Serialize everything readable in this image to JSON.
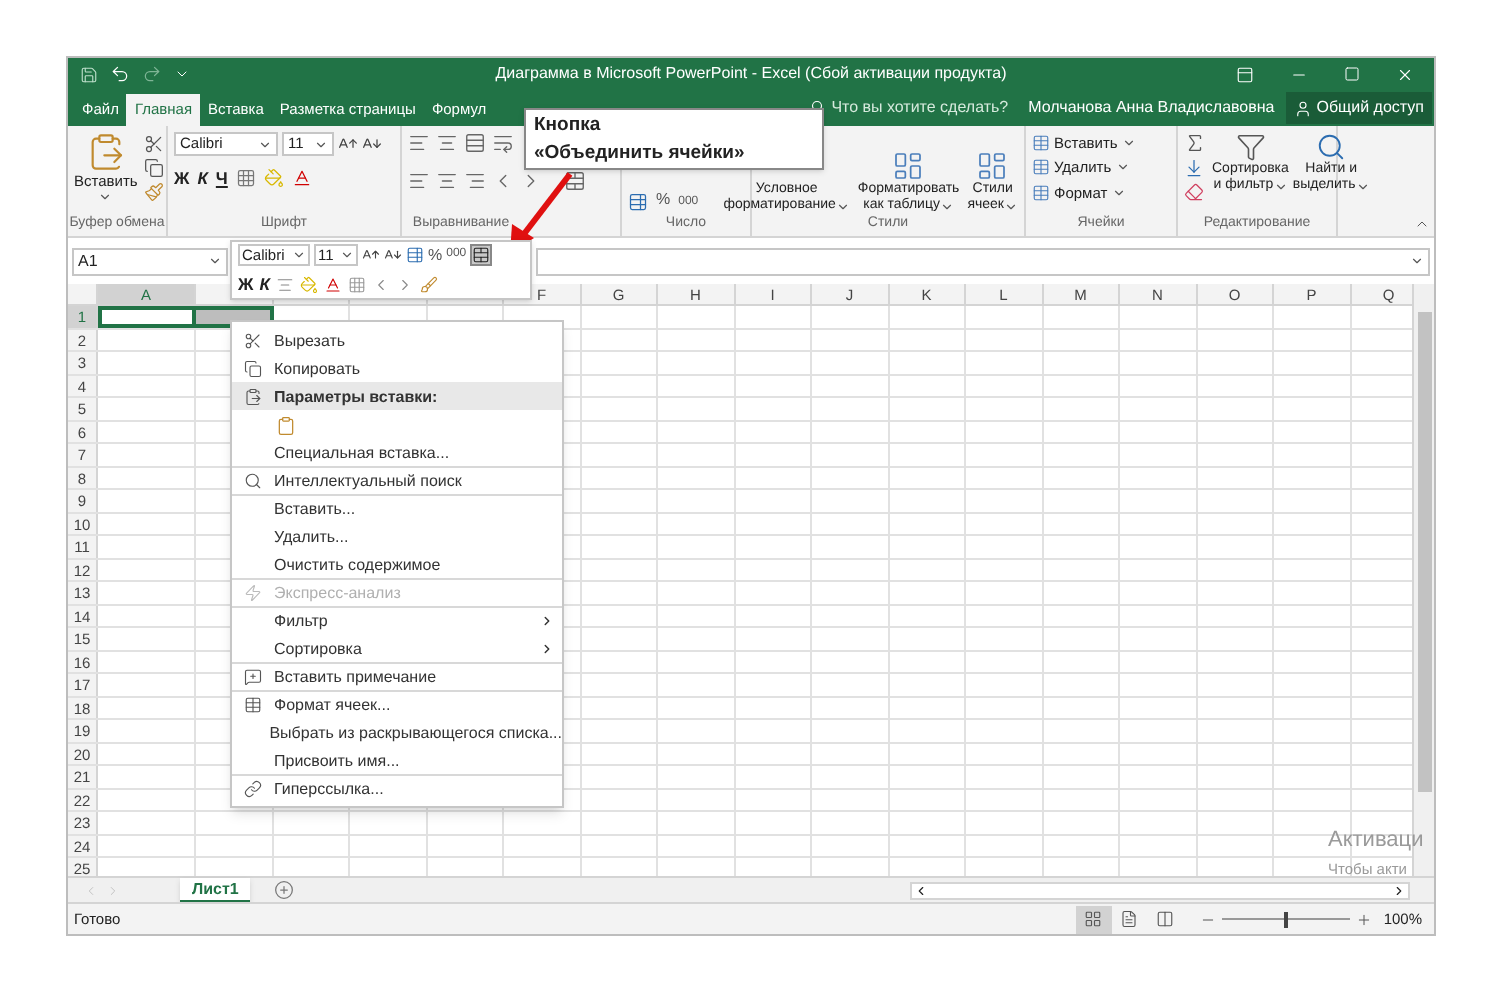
{
  "window": {
    "title": "Диаграмма в Microsoft PowerPoint - Excel (Сбой активации продукта)"
  },
  "tabs": [
    {
      "label": "Файл",
      "selected": false
    },
    {
      "label": "Главная",
      "selected": true
    },
    {
      "label": "Вставка",
      "selected": false
    },
    {
      "label": "Разметка страницы",
      "selected": false
    },
    {
      "label": "Формул",
      "selected": false
    }
  ],
  "tell_me": "Что вы хотите сделать?",
  "user": "Молчанова Анна Владиславовна",
  "share": "Общий доступ",
  "callout": {
    "lines": [
      "Кнопка",
      "«Объединить ячейки»"
    ]
  },
  "ribbon": {
    "clipboard": {
      "label": "Буфер обмена",
      "paste": "Вставить"
    },
    "font": {
      "label": "Шрифт",
      "family": "Calibri",
      "size": "11",
      "bold": "Ж",
      "italic": "К",
      "underline": "Ч"
    },
    "alignment": {
      "label": "Выравнивание"
    },
    "number": {
      "label": "Число",
      "percent": "%",
      "thousands": "000"
    },
    "styles": {
      "label": "Стили",
      "buttons": [
        [
          "Условное",
          "форматирование"
        ],
        [
          "Форматировать",
          "как таблицу"
        ],
        [
          "Стили",
          "ячеек"
        ]
      ]
    },
    "cells": {
      "label": "Ячейки",
      "buttons": [
        "Вставить",
        "Удалить",
        "Формат"
      ]
    },
    "editing": {
      "label": "Редактирование",
      "buttons": [
        [
          "Сортировка",
          "и фильтр"
        ],
        [
          "Найти и",
          "выделить"
        ]
      ]
    }
  },
  "name_box": "A1",
  "mini_toolbar": {
    "family": "Calibri",
    "size": "11",
    "percent": "%",
    "thousands": "000",
    "bold": "Ж",
    "italic": "К"
  },
  "grid": {
    "columns": [
      {
        "label": "A",
        "selected": true
      },
      {
        "selected": true
      },
      {},
      {},
      {},
      {
        "label": "F",
        "selected": false
      },
      {
        "label": "G",
        "selected": false
      },
      {
        "label": "H",
        "selected": false
      },
      {
        "label": "I",
        "selected": false
      },
      {
        "label": "J",
        "selected": false
      },
      {
        "label": "K",
        "selected": false
      },
      {
        "label": "L",
        "selected": false
      },
      {
        "label": "M",
        "selected": false
      },
      {
        "label": "N",
        "selected": false
      },
      {
        "label": "O",
        "selected": false
      },
      {
        "label": "P",
        "selected": false
      },
      {
        "label": "Q",
        "selected": false
      }
    ],
    "rows": [
      {
        "label": "1",
        "selected": true
      },
      {
        "label": "2",
        "selected": false
      },
      {
        "label": "3",
        "selected": false
      },
      {
        "label": "4",
        "selected": false
      },
      {
        "label": "5",
        "selected": false
      },
      {
        "label": "6",
        "selected": false
      },
      {
        "label": "7",
        "selected": false
      },
      {
        "label": "8",
        "selected": false
      },
      {
        "label": "9",
        "selected": false
      },
      {
        "label": "10",
        "selected": false
      },
      {
        "label": "11",
        "selected": false
      },
      {
        "label": "12",
        "selected": false
      },
      {
        "label": "13",
        "selected": false
      },
      {
        "label": "14",
        "selected": false
      },
      {
        "label": "15",
        "selected": false
      },
      {
        "label": "16",
        "selected": false
      },
      {
        "label": "17",
        "selected": false
      },
      {
        "label": "18",
        "selected": false
      },
      {
        "label": "19",
        "selected": false
      },
      {
        "label": "20",
        "selected": false
      },
      {
        "label": "21",
        "selected": false
      },
      {
        "label": "22",
        "selected": false
      },
      {
        "label": "23",
        "selected": false
      },
      {
        "label": "24",
        "selected": false
      },
      {
        "label": "25",
        "selected": false
      }
    ]
  },
  "context_menu": [
    {
      "kind": "item",
      "label": "Вырезать",
      "disabled": false,
      "separator_before": false
    },
    {
      "kind": "item",
      "label": "Копировать",
      "disabled": false,
      "separator_before": false
    },
    {
      "kind": "header",
      "label": "Параметры вставки:",
      "disabled": false,
      "separator_before": false
    },
    {
      "kind": "paste-options",
      "disabled": false
    },
    {
      "kind": "item",
      "label": "Специальная вставка...",
      "disabled": false,
      "separator_before": false
    },
    {
      "kind": "item",
      "label": "Интеллектуальный поиск",
      "disabled": false,
      "separator_before": true
    },
    {
      "kind": "item",
      "label": "Вставить...",
      "disabled": false,
      "separator_before": true
    },
    {
      "kind": "item",
      "label": "Удалить...",
      "disabled": false,
      "separator_before": false
    },
    {
      "kind": "item",
      "label": "Очистить содержимое",
      "disabled": false,
      "separator_before": false
    },
    {
      "kind": "item",
      "label": "Экспресс-анализ",
      "disabled": true,
      "separator_before": true
    },
    {
      "kind": "submenu",
      "label": "Фильтр",
      "disabled": false,
      "separator_before": true
    },
    {
      "kind": "submenu",
      "label": "Сортировка",
      "disabled": false,
      "separator_before": false
    },
    {
      "kind": "item",
      "label": "Вставить примечание",
      "disabled": false,
      "separator_before": true
    },
    {
      "kind": "item",
      "label": "Формат ячеек...",
      "disabled": false,
      "separator_before": true
    },
    {
      "kind": "item",
      "label": "Выбрать из раскрывающегося списка...",
      "disabled": false,
      "separator_before": false
    },
    {
      "kind": "item",
      "label": "Присвоить имя...",
      "disabled": false,
      "separator_before": false
    },
    {
      "kind": "item",
      "label": "Гиперссылка...",
      "disabled": false,
      "separator_before": true
    }
  ],
  "sheets": [
    {
      "label": "Лист1",
      "selected": true
    }
  ],
  "status": "Готово",
  "views": [
    {
      "selected": true
    },
    {
      "selected": false
    },
    {
      "selected": false
    }
  ],
  "zoom": {
    "level": 0.5,
    "reading": "100%"
  },
  "os_notice": [
    "Активаци",
    "Чтобы акти"
  ]
}
